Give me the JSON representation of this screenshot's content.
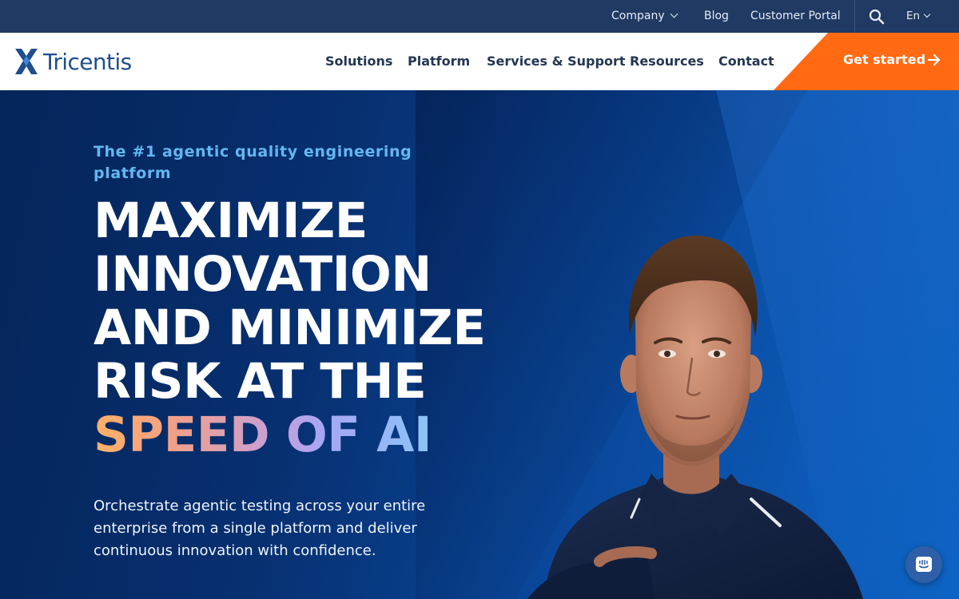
{
  "utility_bar": {
    "company": "Company",
    "blog": "Blog",
    "customer_portal": "Customer Portal",
    "language": "En"
  },
  "nav": {
    "logo_text": "Tricentis",
    "links": [
      "Solutions",
      "Platform",
      "Services & Support",
      "Resources",
      "Contact"
    ],
    "cta": "Get started"
  },
  "hero": {
    "eyebrow": "The #1 agentic quality engineering platform",
    "headline_lines": [
      "MAXIMIZE",
      "INNOVATION",
      "AND MINIMIZE",
      "RISK AT THE"
    ],
    "headline_highlight": "SPEED OF AI",
    "subtext": "Orchestrate agentic testing across your entire enterprise from a single platform and deliver continuous innovation with confidence."
  },
  "colors": {
    "utility_bg": "#203a63",
    "nav_bg": "#ffffff",
    "brand_blue": "#1f4e8c",
    "cta_orange": "#ff6a13",
    "eyebrow_blue": "#63b7f0",
    "hero_bg": "#08357a"
  },
  "icons": {
    "search": "search-icon",
    "chat": "chat-icon",
    "arrow": "arrow-right-icon",
    "logo_mark": "tricentis-x-logo-icon"
  }
}
